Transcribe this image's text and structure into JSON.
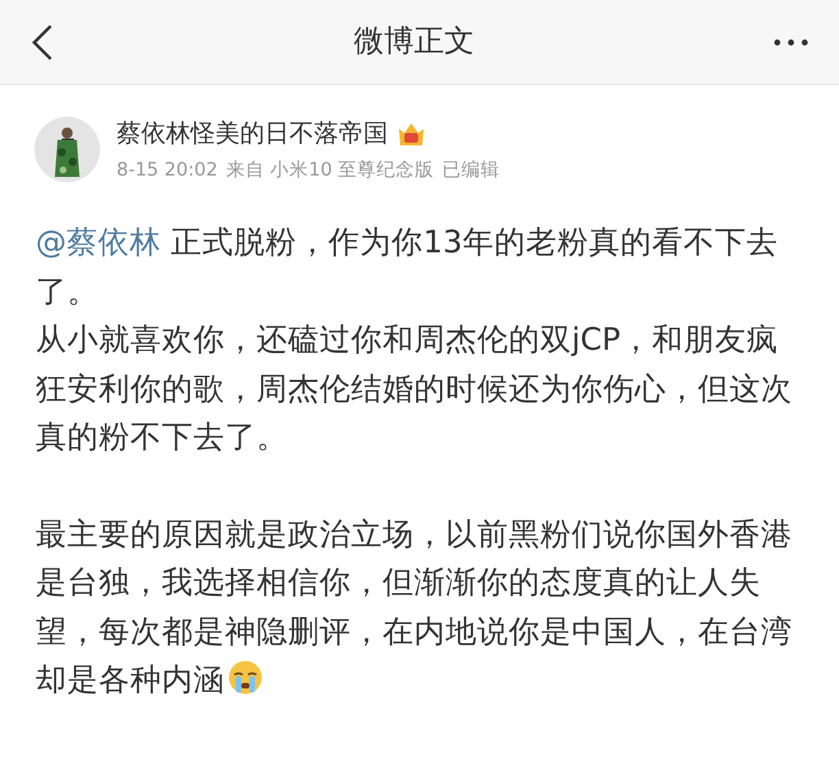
{
  "header": {
    "title": "微博正文"
  },
  "post": {
    "author": "蔡依林怪美的日不落帝国",
    "time": "8-15 20:02",
    "source": "来自 小米10 至尊纪念版",
    "edited": "已编辑",
    "blocks": [
      {
        "paragraphs": [
          {
            "mention": "@蔡依林",
            "text": " 正式脱粉，作为你13年的老粉真的看不下去了。",
            "emoji": false
          },
          {
            "text": "从小就喜欢你，还磕过你和周杰伦的双jCP，和朋友疯狂安利你的歌，周杰伦结婚的时候还为你伤心，但这次真的粉不下去了。",
            "emoji": false
          }
        ]
      },
      {
        "paragraphs": [
          {
            "text": "最主要的原因就是政治立场，以前黑粉们说你国外香港是台独，我选择相信你，但渐渐你的态度真的让人失望，每次都是神隐删评，在内地说你是中国人，在台湾却是各种内涵",
            "emoji": true
          }
        ]
      }
    ]
  }
}
